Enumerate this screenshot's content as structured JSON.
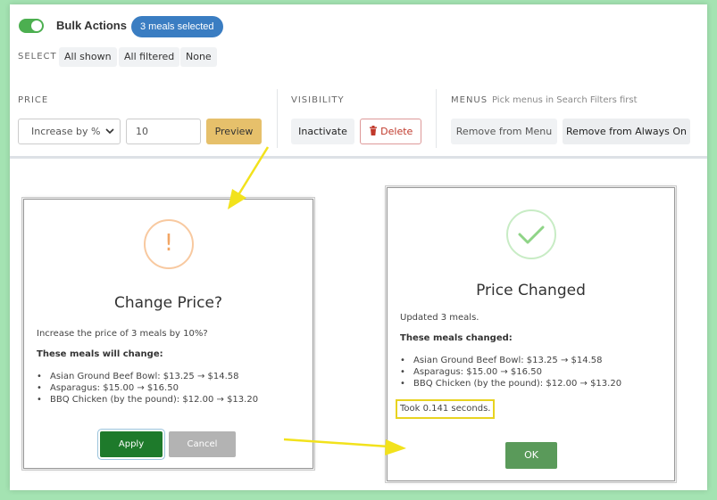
{
  "toolbar": {
    "bulk_title": "Bulk Actions",
    "selected_badge": "3 meals selected",
    "select_label": "SELECT",
    "select_options": [
      "All shown",
      "All filtered",
      "None"
    ],
    "price": {
      "label": "PRICE",
      "mode_value": "Increase by %",
      "amount_value": "10",
      "preview_label": "Preview"
    },
    "visibility": {
      "label": "VISIBILITY",
      "inactivate_label": "Inactivate",
      "delete_label": "Delete"
    },
    "menus": {
      "label": "MENUS",
      "hint": "Pick menus in Search Filters first",
      "remove_from_menu_label": "Remove from Menu",
      "remove_from_always_on_label": "Remove from Always On"
    }
  },
  "change_price_modal": {
    "title": "Change Price?",
    "message": "Increase the price of 3 meals by 10%?",
    "list_heading": "These meals will change:",
    "meals": [
      "Asian Ground Beef Bowl: $13.25 → $14.58",
      "Asparagus: $15.00 → $16.50",
      "BBQ Chicken (by the pound): $12.00 → $13.20"
    ],
    "apply_label": "Apply",
    "cancel_label": "Cancel"
  },
  "price_changed_modal": {
    "title": "Price Changed",
    "message": "Updated 3 meals.",
    "list_heading": "These meals changed:",
    "meals": [
      "Asian Ground Beef Bowl: $13.25 → $14.58",
      "Asparagus: $15.00 → $16.50",
      "BBQ Chicken (by the pound): $12.00 → $13.20"
    ],
    "timing": "Took 0.141 seconds.",
    "ok_label": "OK"
  },
  "colors": {
    "background": "#a4e3b2",
    "accent_green": "#4caf50",
    "badge_blue": "#3a7dc2",
    "preview_yellow": "#e6c06b",
    "apply_green": "#1e7a2b",
    "ok_green": "#5a9a5a",
    "annotation_yellow": "#e8d320",
    "delete_red": "#c0392b"
  },
  "icons": {
    "toggle": "toggle-switch-on",
    "delete": "trash-icon",
    "warning": "exclamation-circle-icon",
    "success": "checkmark-circle-icon"
  }
}
